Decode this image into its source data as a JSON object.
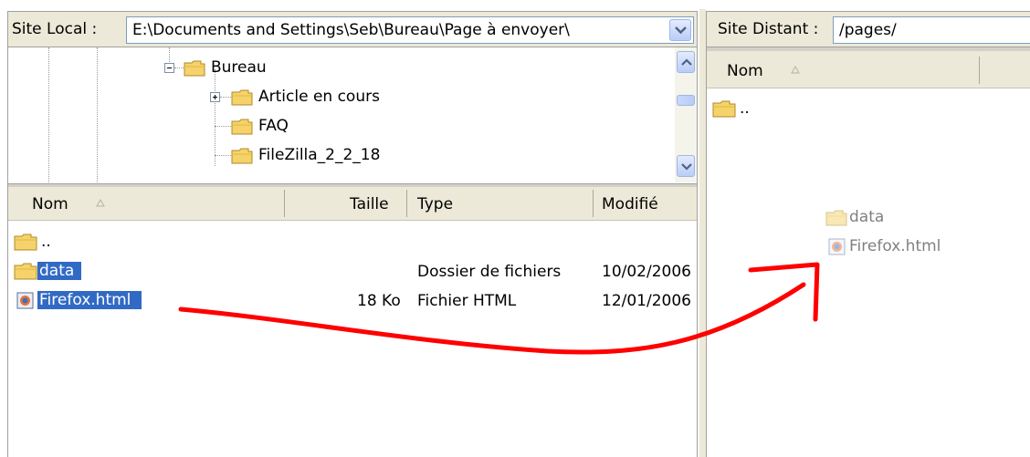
{
  "local": {
    "label": "Site Local :",
    "path": "E:\\Documents and Settings\\Seb\\Bureau\\Page à envoyer\\",
    "tree": {
      "items": [
        {
          "label": "Bureau"
        },
        {
          "label": "Article en cours"
        },
        {
          "label": "FAQ"
        },
        {
          "label": "FileZilla_2_2_18"
        }
      ]
    },
    "list": {
      "columns": {
        "name": "Nom",
        "size": "Taille",
        "type": "Type",
        "modified": "Modifié"
      },
      "rows": [
        {
          "name": "..",
          "size": "",
          "type": "",
          "modified": ""
        },
        {
          "name": "data",
          "size": "",
          "type": "Dossier de fichiers",
          "modified": "10/02/2006"
        },
        {
          "name": "Firefox.html",
          "size": "18 Ko",
          "type": "Fichier HTML",
          "modified": "12/01/2006"
        }
      ]
    }
  },
  "remote": {
    "label": "Site Distant :",
    "path": "/pages/",
    "list": {
      "columns": {
        "name": "Nom"
      },
      "rows": [
        {
          "name": ".."
        }
      ]
    },
    "drag_preview": [
      {
        "name": "data"
      },
      {
        "name": "Firefox.html"
      }
    ]
  },
  "colors": {
    "selection": "#316ac5",
    "annotation_arrow": "#ff0000",
    "folder": "#f5d36a",
    "chrome": "#ece9d8"
  }
}
